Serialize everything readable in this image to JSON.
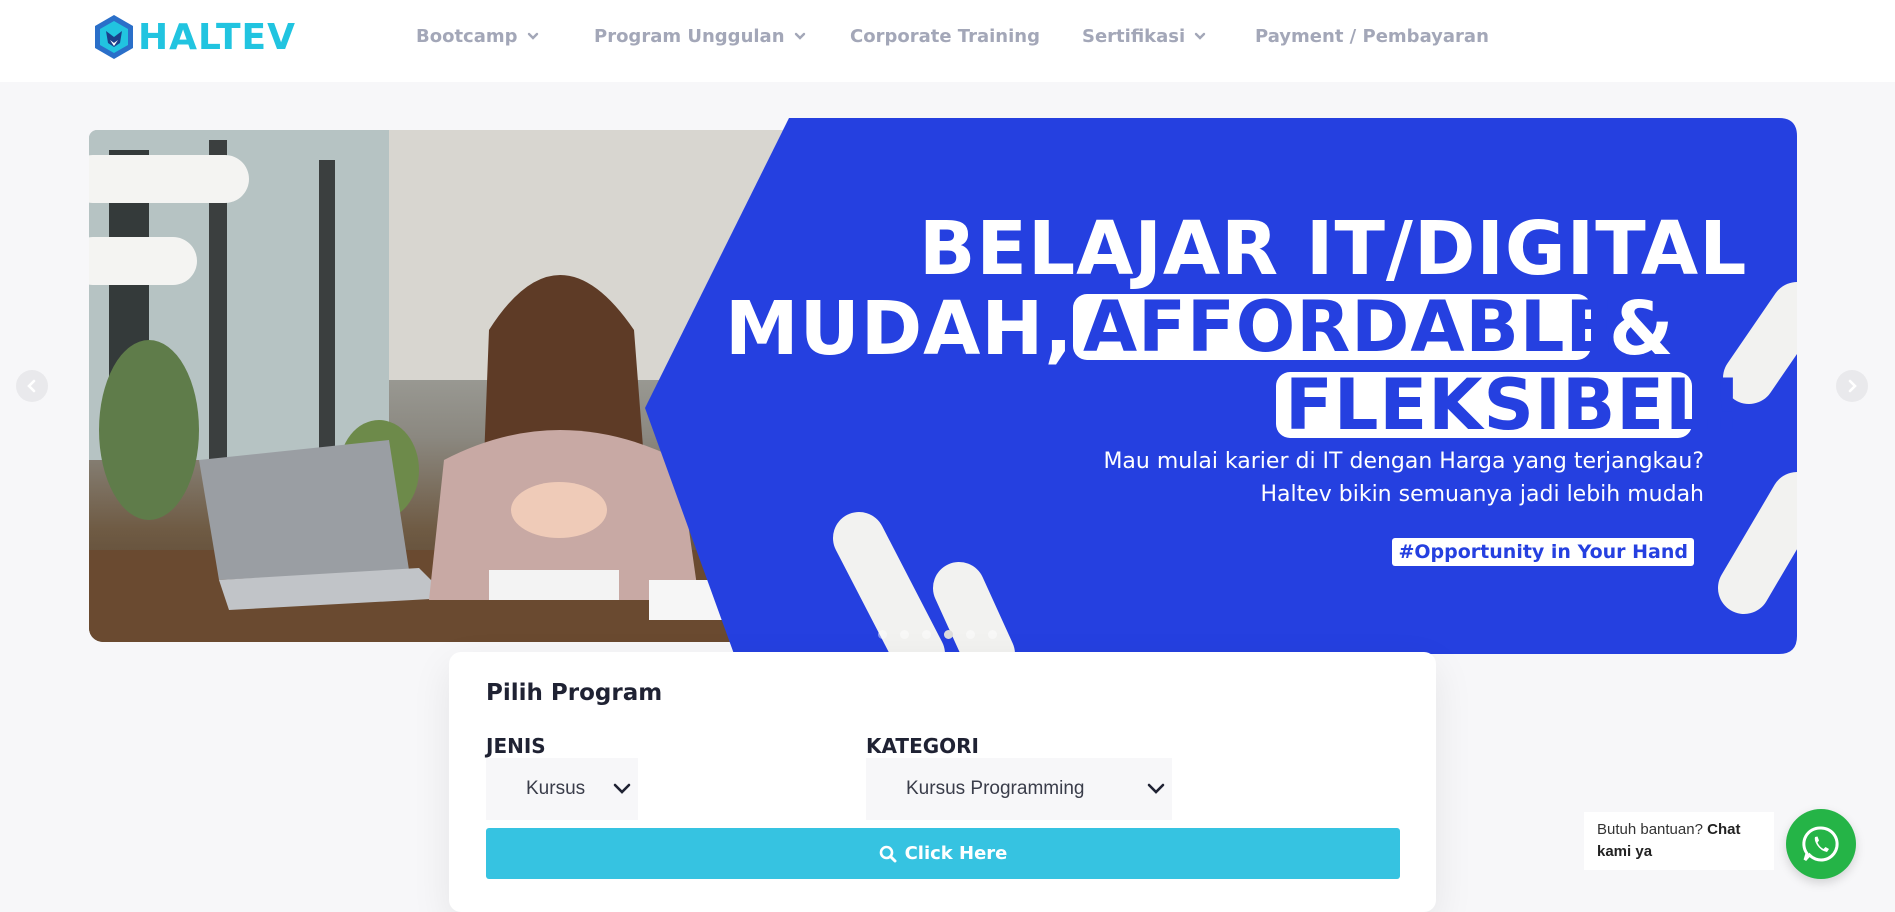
{
  "brand": {
    "logo_text": "HALTEV",
    "logo_color": "#21c4e0"
  },
  "nav": {
    "items": [
      {
        "label": "Bootcamp",
        "has_dropdown": true
      },
      {
        "label": "Program Unggulan",
        "has_dropdown": true
      },
      {
        "label": "Corporate Training",
        "has_dropdown": false
      },
      {
        "label": "Sertifikasi",
        "has_dropdown": true
      },
      {
        "label": "Payment / Pembayaran",
        "has_dropdown": false
      }
    ]
  },
  "banner": {
    "headline_line1": "BELAJAR IT/DIGITAL",
    "headline_line2_a": "MUDAH,",
    "headline_line2_b": "AFFORDABLE,",
    "headline_line2_c": "&",
    "headline_line3": "FLEKSIBEL!",
    "subtitle_line1": "Mau mulai karier di IT dengan Harga yang terjangkau?",
    "subtitle_line2": "Haltev bikin semuanya jadi lebih mudah",
    "hashtag": "#Opportunity in Your Hand",
    "accent_color": "#2540e0",
    "slide_count": 6,
    "active_slide": 4
  },
  "program_card": {
    "title": "Pilih Program",
    "jenis_label": "JENIS",
    "jenis_value": "Kursus",
    "kategori_label": "KATEGORI",
    "kategori_value": "Kursus Programming",
    "button_label": "Click Here",
    "button_color": "#36c3e1"
  },
  "chat": {
    "prompt": "Butuh bantuan?",
    "prompt_bold": "Chat kami ya",
    "whatsapp_color": "#25b447"
  },
  "icons": {
    "logo": "hexagon-fox-logo-icon",
    "search": "search-icon",
    "prev": "chevron-left-icon",
    "next": "chevron-right-icon",
    "dropdown": "chevron-down-icon",
    "whatsapp": "whatsapp-icon"
  }
}
